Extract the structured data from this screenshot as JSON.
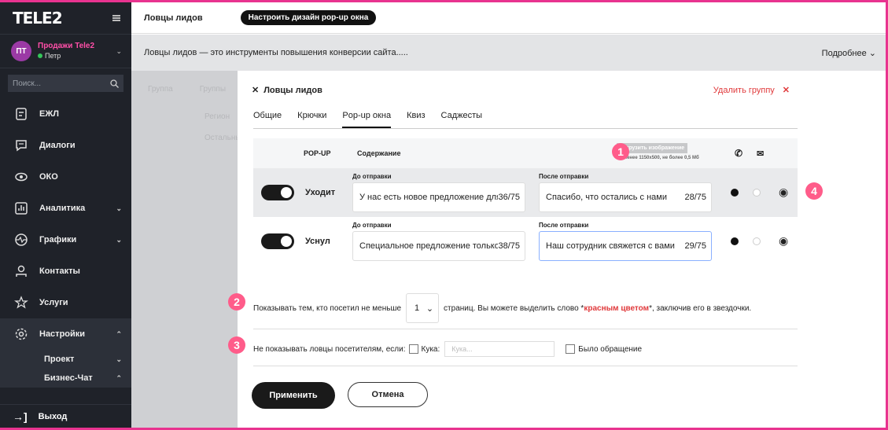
{
  "sidebar": {
    "logo": "TELE2",
    "account": {
      "initials": "ПТ",
      "name": "Продажи Tele2",
      "user": "Петр"
    },
    "search_placeholder": "Поиск...",
    "items": [
      {
        "label": "ЕЖЛ"
      },
      {
        "label": "Диалоги"
      },
      {
        "label": "ОКО"
      },
      {
        "label": "Аналитика"
      },
      {
        "label": "Графики"
      },
      {
        "label": "Контакты"
      },
      {
        "label": "Услуги"
      },
      {
        "label": "Настройки"
      }
    ],
    "sub_items": [
      {
        "label": "Проект"
      },
      {
        "label": "Бизнес-Чат"
      }
    ],
    "logout": "Выход"
  },
  "header": {
    "title": "Ловцы лидов",
    "design_button": "Настроить дизайн pop-up окна"
  },
  "infobar": {
    "text": "Ловцы лидов — это инструменты повышения конверсии сайта.....",
    "more": "Подробнее"
  },
  "background": {
    "col1": "Группа",
    "col2": "Группы",
    "r1": "Регион",
    "r2": "Остальные"
  },
  "modal": {
    "title": "Ловцы лидов",
    "delete": "Удалить группу",
    "tabs": [
      "Общие",
      "Крючки",
      "Pop-up окна",
      "Квиз",
      "Саджесты"
    ],
    "table": {
      "col_popup": "POP-UP",
      "col_content": "Содержание",
      "upload": "Загрузить изображение",
      "upload_note": "не менее 1150x500, не более 0,5 Мб",
      "rows": [
        {
          "label": "Уходит",
          "before_label": "До отправки",
          "before": "У нас есть новое предложение для ва",
          "before_count": "36/75",
          "after_label": "После отправки",
          "after": "Спасибо, что остались с нами",
          "after_count": "28/75"
        },
        {
          "label": "Уснул",
          "before_label": "До отправки",
          "before": "Специальное предложение только дл",
          "before_count": "38/75",
          "after_label": "После отправки",
          "after": "Наш сотрудник свяжется с вами",
          "after_count": "29/75"
        }
      ]
    },
    "show_text_1": "Показывать тем, кто посетил не меньше",
    "pages_value": "1",
    "show_text_2": "страниц. Вы можете выделить слово *",
    "red_word": "красным цветом",
    "show_text_3": "*, заключив его в звездочки.",
    "hide_text": "Не показывать ловцы посетителям, если:",
    "cookie_label": "Кука:",
    "cookie_placeholder": "Кука...",
    "contacted_label": "Было обращение",
    "apply": "Применить",
    "cancel": "Отмена"
  },
  "badges": [
    "1",
    "2",
    "3",
    "4"
  ],
  "colors": {
    "accent": "#e8338f",
    "badge": "#ff5c8a",
    "danger": "#e0393b",
    "sidebar": "#1f2229"
  }
}
